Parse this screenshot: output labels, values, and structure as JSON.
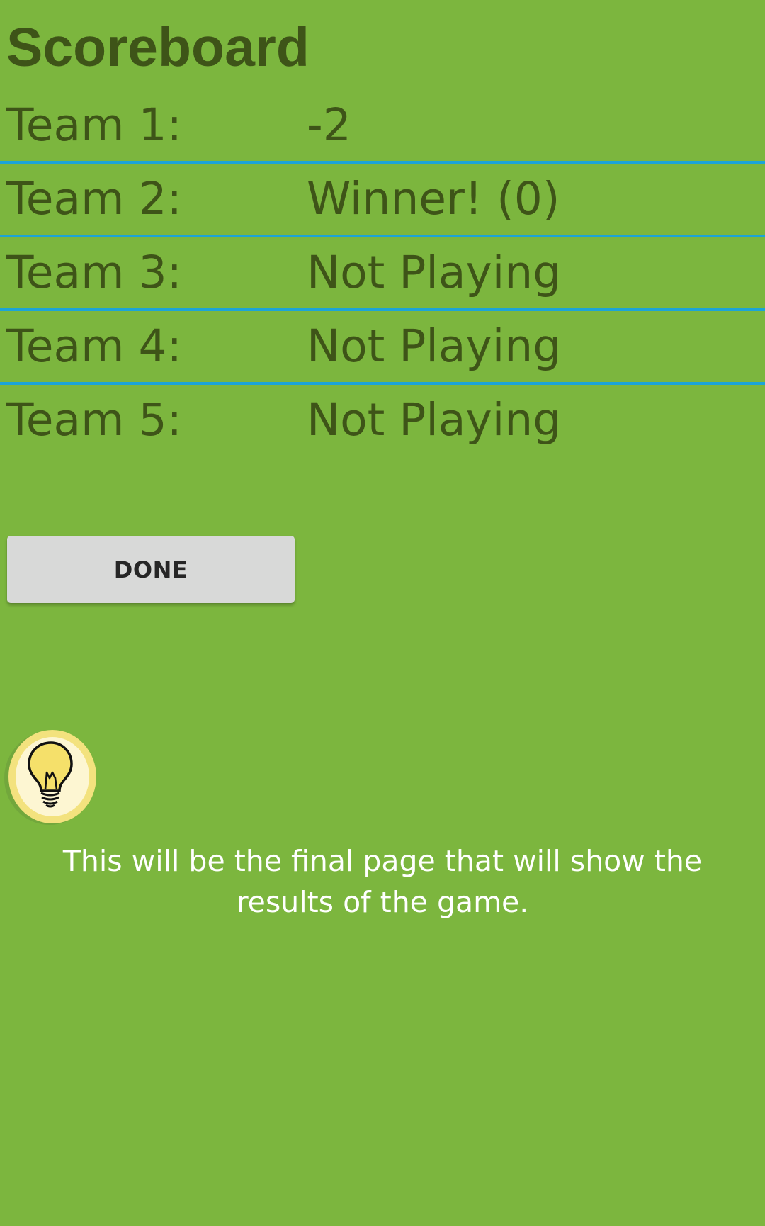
{
  "header": {
    "title": "Scoreboard"
  },
  "scoreboard": {
    "rows": [
      {
        "label": "Team 1:",
        "value": "-2"
      },
      {
        "label": "Team 2:",
        "value": "Winner! (0)"
      },
      {
        "label": "Team 3:",
        "value": "Not Playing"
      },
      {
        "label": "Team 4:",
        "value": "Not Playing"
      },
      {
        "label": "Team 5:",
        "value": "Not Playing"
      }
    ]
  },
  "actions": {
    "done_label": "DONE"
  },
  "hint": {
    "icon": "lightbulb-icon",
    "text": "This will be the final page that will show the results of the game."
  },
  "colors": {
    "background": "#7cb63e",
    "text": "#3e5418",
    "divider": "#1ba4d8",
    "button": "#d8d9d8"
  }
}
